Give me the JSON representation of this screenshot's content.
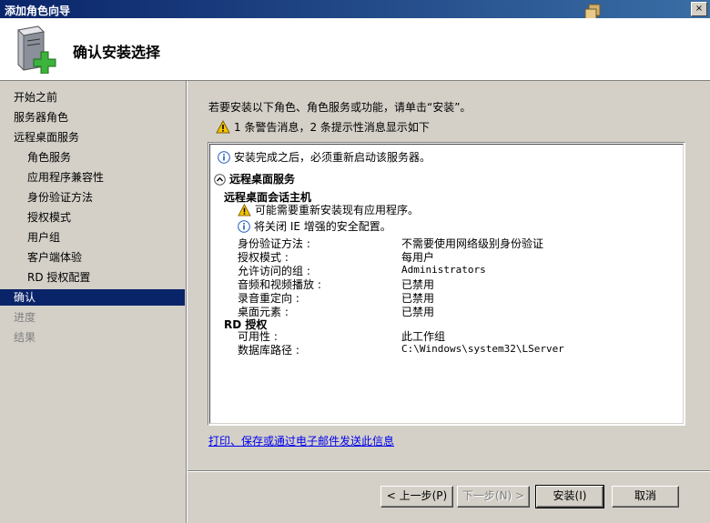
{
  "window": {
    "title": "添加角色向导",
    "close_label": "×"
  },
  "header": {
    "title": "确认安装选择"
  },
  "sidebar": {
    "items": [
      {
        "label": "开始之前",
        "level": "top",
        "state": "normal"
      },
      {
        "label": "服务器角色",
        "level": "top",
        "state": "normal"
      },
      {
        "label": "远程桌面服务",
        "level": "top",
        "state": "normal"
      },
      {
        "label": "角色服务",
        "level": "sub",
        "state": "normal"
      },
      {
        "label": "应用程序兼容性",
        "level": "sub",
        "state": "normal"
      },
      {
        "label": "身份验证方法",
        "level": "sub",
        "state": "normal"
      },
      {
        "label": "授权模式",
        "level": "sub",
        "state": "normal"
      },
      {
        "label": "用户组",
        "level": "sub",
        "state": "normal"
      },
      {
        "label": "客户端体验",
        "level": "sub",
        "state": "normal"
      },
      {
        "label": "RD 授权配置",
        "level": "sub",
        "state": "normal"
      },
      {
        "label": "确认",
        "level": "top",
        "state": "selected"
      },
      {
        "label": "进度",
        "level": "top",
        "state": "disabled"
      },
      {
        "label": "结果",
        "level": "top",
        "state": "disabled"
      }
    ]
  },
  "main": {
    "intro": "若要安装以下角色、角色服务或功能，请单击“安装”。",
    "warning_summary": "1 条警告消息，2 条提示性消息显示如下",
    "info_restart": "安装完成之后，必须重新启动该服务器。",
    "section_title": "远程桌面服务",
    "session_host_title": "远程桌面会话主机",
    "warn_reinstall": "可能需要重新安装现有应用程序。",
    "info_ie": "将关闭 IE 增强的安全配置。",
    "settings": [
      {
        "key": "身份验证方法 :",
        "value": "不需要使用网络级别身份验证"
      },
      {
        "key": "授权模式 :",
        "value": "每用户"
      },
      {
        "key": "允许访问的组 :",
        "value": "Administrators"
      },
      {
        "key": "音频和视频播放 :",
        "value": "已禁用"
      },
      {
        "key": "录音重定向 :",
        "value": "已禁用"
      },
      {
        "key": "桌面元素 :",
        "value": "已禁用"
      }
    ],
    "rd_licensing_title": "RD 授权",
    "rd_settings": [
      {
        "key": "可用性 :",
        "value": "此工作组"
      },
      {
        "key": "数据库路径 :",
        "value": "C:\\Windows\\system32\\LServer"
      }
    ],
    "link": "打印、保存或通过电子邮件发送此信息"
  },
  "buttons": {
    "prev": "< 上一步(P)",
    "next": "下一步(N) >",
    "install": "安装(I)",
    "cancel": "取消"
  },
  "colors": {
    "title_bar": "#0a246a",
    "selection": "#0a246a",
    "link": "#0000ee",
    "warning": "#f5c400",
    "info": "#1e5bb8"
  }
}
